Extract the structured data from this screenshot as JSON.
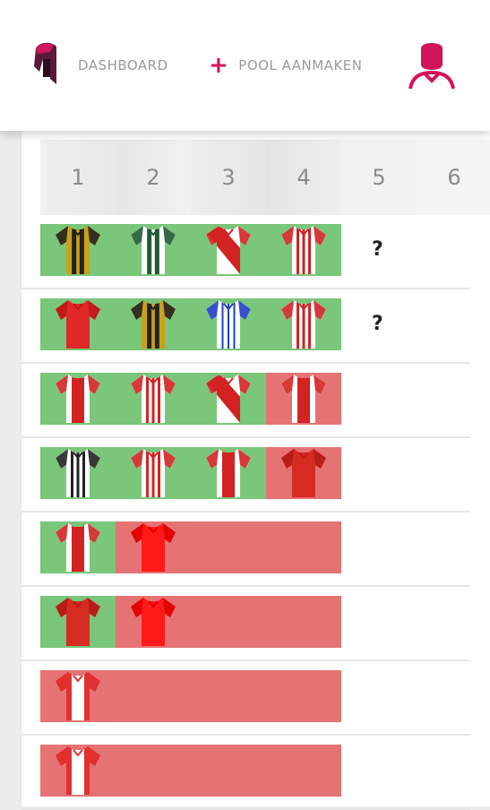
{
  "nav": {
    "dashboard_label": "DASHBOARD",
    "create_plus": "+",
    "create_label": "POOL AANMAKEN",
    "brand_color": "#d1155b"
  },
  "columns": [
    "1",
    "2",
    "3",
    "4",
    "5",
    "6"
  ],
  "rows": [
    {
      "shirts": [
        "yellow-black-stripes",
        "white-green-stripes",
        "red-white-sash",
        "white-red-stripes"
      ],
      "results": [
        "win",
        "win",
        "win",
        "win"
      ],
      "extra": "?"
    },
    {
      "shirts": [
        "red-plain",
        "yellow-black-stripes",
        "white-blue-stripes",
        "white-red-stripes"
      ],
      "results": [
        "win",
        "win",
        "win",
        "win"
      ],
      "extra": "?"
    },
    {
      "shirts": [
        "white-red-panel",
        "white-red-stripes",
        "red-white-sash",
        "white-red-panel"
      ],
      "results": [
        "win",
        "win",
        "win",
        "lose"
      ],
      "extra": ""
    },
    {
      "shirts": [
        "white-black-stripes",
        "white-red-stripes",
        "white-red-panel",
        "red-dark-plain"
      ],
      "results": [
        "win",
        "win",
        "win",
        "lose"
      ],
      "extra": ""
    },
    {
      "shirts": [
        "white-red-panel",
        "red-bright-plain",
        "",
        ""
      ],
      "results": [
        "win",
        "lose",
        "empty",
        "empty"
      ],
      "extra": ""
    },
    {
      "shirts": [
        "red-dark-plain",
        "red-bright-plain",
        "",
        ""
      ],
      "results": [
        "win",
        "lose",
        "empty",
        "empty"
      ],
      "extra": ""
    },
    {
      "shirts": [
        "red-white-panel",
        "",
        "",
        ""
      ],
      "results": [
        "lose",
        "empty",
        "empty",
        "empty"
      ],
      "extra": ""
    },
    {
      "shirts": [
        "red-white-panel",
        "",
        "",
        ""
      ],
      "results": [
        "lose",
        "empty",
        "empty",
        "empty"
      ],
      "extra": ""
    }
  ],
  "colors": {
    "win": "#7ac67a",
    "lose": "#e57373"
  }
}
